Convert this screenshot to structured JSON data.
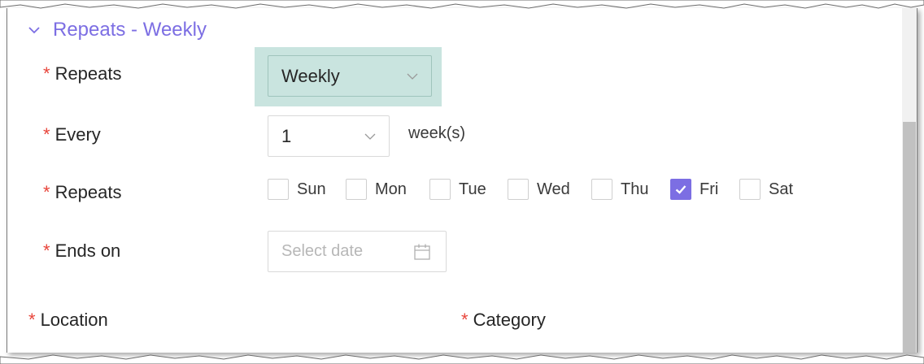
{
  "section": {
    "title": "Repeats - Weekly",
    "icon": "chevron-down-icon"
  },
  "form": {
    "repeats": {
      "label": "Repeats",
      "required_mark": "*",
      "value": "Weekly"
    },
    "every": {
      "label": "Every",
      "required_mark": "*",
      "value": "1",
      "unit": "week(s)"
    },
    "days": {
      "label": "Repeats",
      "required_mark": "*",
      "options": [
        {
          "label": "Sun",
          "checked": false
        },
        {
          "label": "Mon",
          "checked": false
        },
        {
          "label": "Tue",
          "checked": false
        },
        {
          "label": "Wed",
          "checked": false
        },
        {
          "label": "Thu",
          "checked": false
        },
        {
          "label": "Fri",
          "checked": true
        },
        {
          "label": "Sat",
          "checked": false
        }
      ]
    },
    "ends_on": {
      "label": "Ends on",
      "required_mark": "*",
      "placeholder": "Select date",
      "icon": "calendar-icon"
    },
    "location": {
      "label": "Location",
      "required_mark": "*"
    },
    "category": {
      "label": "Category",
      "required_mark": "*"
    }
  },
  "colors": {
    "accent": "#7c6ee3",
    "required": "#e8443a",
    "highlight": "#c9e4df"
  }
}
